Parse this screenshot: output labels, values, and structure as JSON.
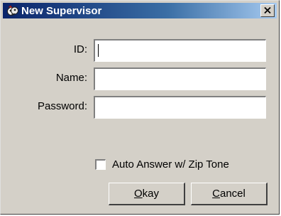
{
  "window": {
    "title": "New Supervisor",
    "icon": "supervisor-app-icon",
    "close_icon": "close-icon",
    "titlebar_color_start": "#0a246a",
    "titlebar_color_end": "#a6caf0",
    "face_color": "#d4d0c8"
  },
  "form": {
    "id": {
      "label": "ID:",
      "value": ""
    },
    "name": {
      "label": "Name:",
      "value": ""
    },
    "password": {
      "label": "Password:",
      "value": ""
    }
  },
  "auto_answer": {
    "label": "Auto Answer w/ Zip Tone",
    "checked": false
  },
  "buttons": {
    "okay": {
      "mnemonic": "O",
      "rest": "kay"
    },
    "cancel": {
      "mnemonic": "C",
      "rest": "ancel"
    }
  }
}
